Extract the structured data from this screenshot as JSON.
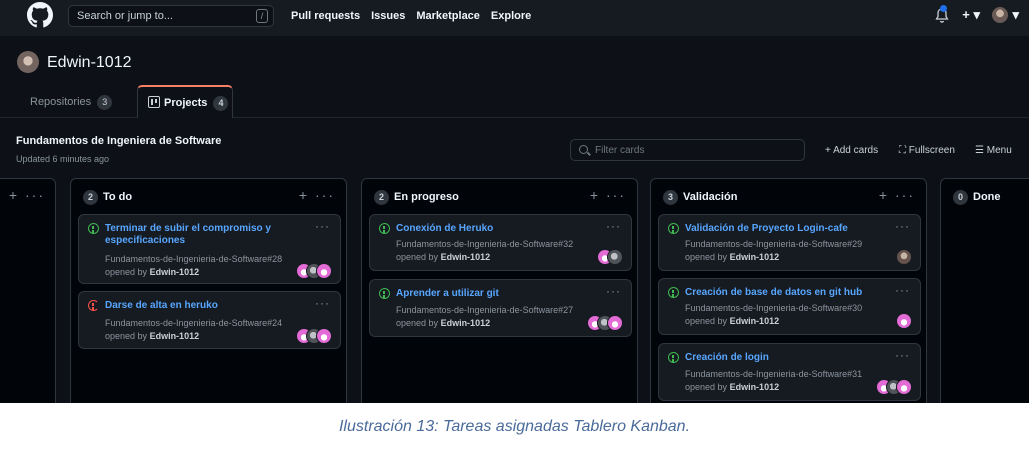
{
  "header": {
    "search_placeholder": "Search or jump to...",
    "search_shortcut": "/",
    "nav": [
      "Pull requests",
      "Issues",
      "Marketplace",
      "Explore"
    ],
    "plus_label": "+ ▾",
    "avatar_caret": "▾"
  },
  "profile": {
    "username": "Edwin-1012",
    "tabs": [
      {
        "label": "Repositories",
        "count": "3"
      },
      {
        "label": "Projects",
        "count": "4"
      }
    ]
  },
  "project": {
    "title": "Fundamentos de Ingeniera de Software",
    "updated": "Updated 6 minutes ago",
    "filter_placeholder": "Filter cards",
    "add_cards": "+ Add cards",
    "fullscreen": "Fullscreen",
    "menu": "Menu"
  },
  "columns": [
    {
      "name": "",
      "count": ""
    },
    {
      "name": "To do",
      "count": "2",
      "cards": [
        {
          "title": "Terminar de subir el compromiso y especificaciones",
          "repo": "Fundamentos-de-Ingenieria-de-Software#28",
          "opened_prefix": "opened by",
          "author": "Edwin-1012",
          "status": "open"
        },
        {
          "title": "Darse de alta en heruko",
          "repo": "Fundamentos-de-Ingenieria-de-Software#24",
          "opened_prefix": "opened by",
          "author": "Edwin-1012",
          "status": "closed"
        }
      ]
    },
    {
      "name": "En progreso",
      "count": "2",
      "cards": [
        {
          "title": "Conexión de Heruko",
          "repo": "Fundamentos-de-Ingenieria-de-Software#32",
          "opened_prefix": "opened by",
          "author": "Edwin-1012",
          "status": "open"
        },
        {
          "title": "Aprender a utilizar git",
          "repo": "Fundamentos-de-Ingenieria-de-Software#27",
          "opened_prefix": "opened by",
          "author": "Edwin-1012",
          "status": "open"
        }
      ]
    },
    {
      "name": "Validación",
      "count": "3",
      "cards": [
        {
          "title": "Validación de Proyecto Login-cafe",
          "repo": "Fundamentos-de-Ingenieria-de-Software#29",
          "opened_prefix": "opened by",
          "author": "Edwin-1012",
          "status": "open"
        },
        {
          "title": "Creación de base de datos en git hub",
          "repo": "Fundamentos-de-Ingenieria-de-Software#30",
          "opened_prefix": "opened by",
          "author": "Edwin-1012",
          "status": "open"
        },
        {
          "title": "Creación de login",
          "repo": "Fundamentos-de-Ingenieria-de-Software#31",
          "opened_prefix": "opened by",
          "author": "Edwin-1012",
          "status": "open"
        }
      ]
    },
    {
      "name": "Done",
      "count": "0"
    }
  ],
  "col_plus": "+",
  "col_more": "···",
  "card_more": "···",
  "caption": "Ilustración 13: Tareas asignadas Tablero Kanban.",
  "colors": {
    "accent": "#f78166",
    "link": "#58a6ff",
    "open": "#3fb950",
    "closed": "#f85149"
  }
}
